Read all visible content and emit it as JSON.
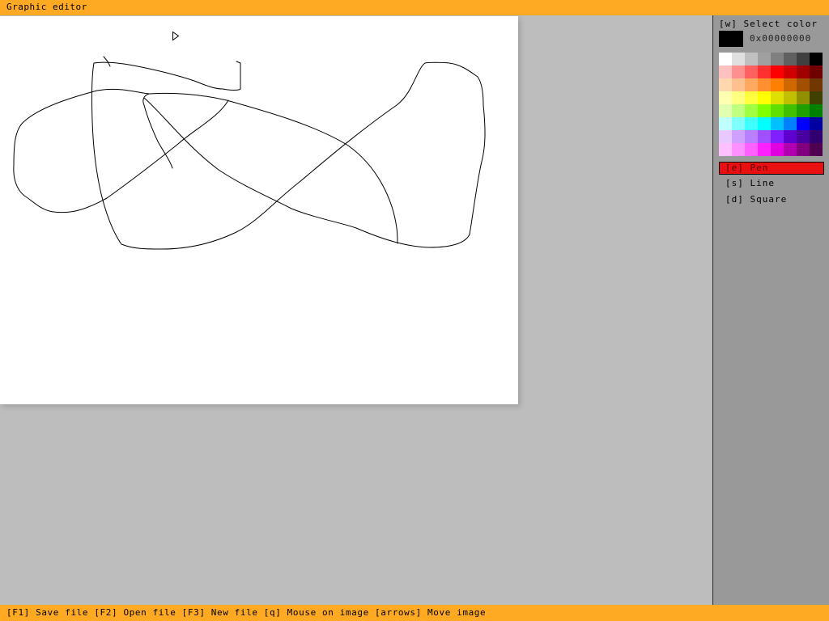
{
  "window": {
    "title": "Graphic editor"
  },
  "sidebar": {
    "select_color_label": "[w] Select color",
    "current_color": {
      "value": "#000000",
      "hex_text": "0x00000000"
    },
    "palette": [
      "#ffffff",
      "#e0e0e0",
      "#c0c0c0",
      "#a0a0a0",
      "#808080",
      "#606060",
      "#404040",
      "#000000",
      "#ffc0c0",
      "#ff9090",
      "#ff6060",
      "#ff3030",
      "#ff0000",
      "#d00000",
      "#a00000",
      "#700000",
      "#ffd8b0",
      "#ffc090",
      "#ffa860",
      "#ff9030",
      "#ff8000",
      "#d06800",
      "#a05000",
      "#703800",
      "#ffffb0",
      "#ffff80",
      "#ffff40",
      "#ffff00",
      "#e0e000",
      "#c0c000",
      "#909000",
      "#404000",
      "#e0ffb0",
      "#c0ff80",
      "#a0ff40",
      "#80ff00",
      "#60e000",
      "#40c000",
      "#20a000",
      "#008000",
      "#c0ffff",
      "#80ffff",
      "#40ffff",
      "#00ffff",
      "#00c0ff",
      "#0080ff",
      "#0000ff",
      "#0000a0",
      "#e8c8ff",
      "#d0a0ff",
      "#b880ff",
      "#a050ff",
      "#8020ff",
      "#6000d0",
      "#4800a0",
      "#300070",
      "#ffc0ff",
      "#ff90ff",
      "#ff60ff",
      "#ff20ff",
      "#e000e0",
      "#b000b0",
      "#800080",
      "#500050"
    ],
    "tools": [
      {
        "label": "[e] Pen",
        "active": true
      },
      {
        "label": "[s] Line",
        "active": false
      },
      {
        "label": "[d] Square",
        "active": false
      }
    ]
  },
  "statusbar": {
    "commands": "[F1] Save file [F2] Open file [F3] New file [q] Mouse on image [arrows] Move image"
  },
  "colors": {
    "accent": "#ffaa22",
    "workspace": "#bdbdbd",
    "sidebar": "#999999",
    "active_tool": "#e81010"
  }
}
